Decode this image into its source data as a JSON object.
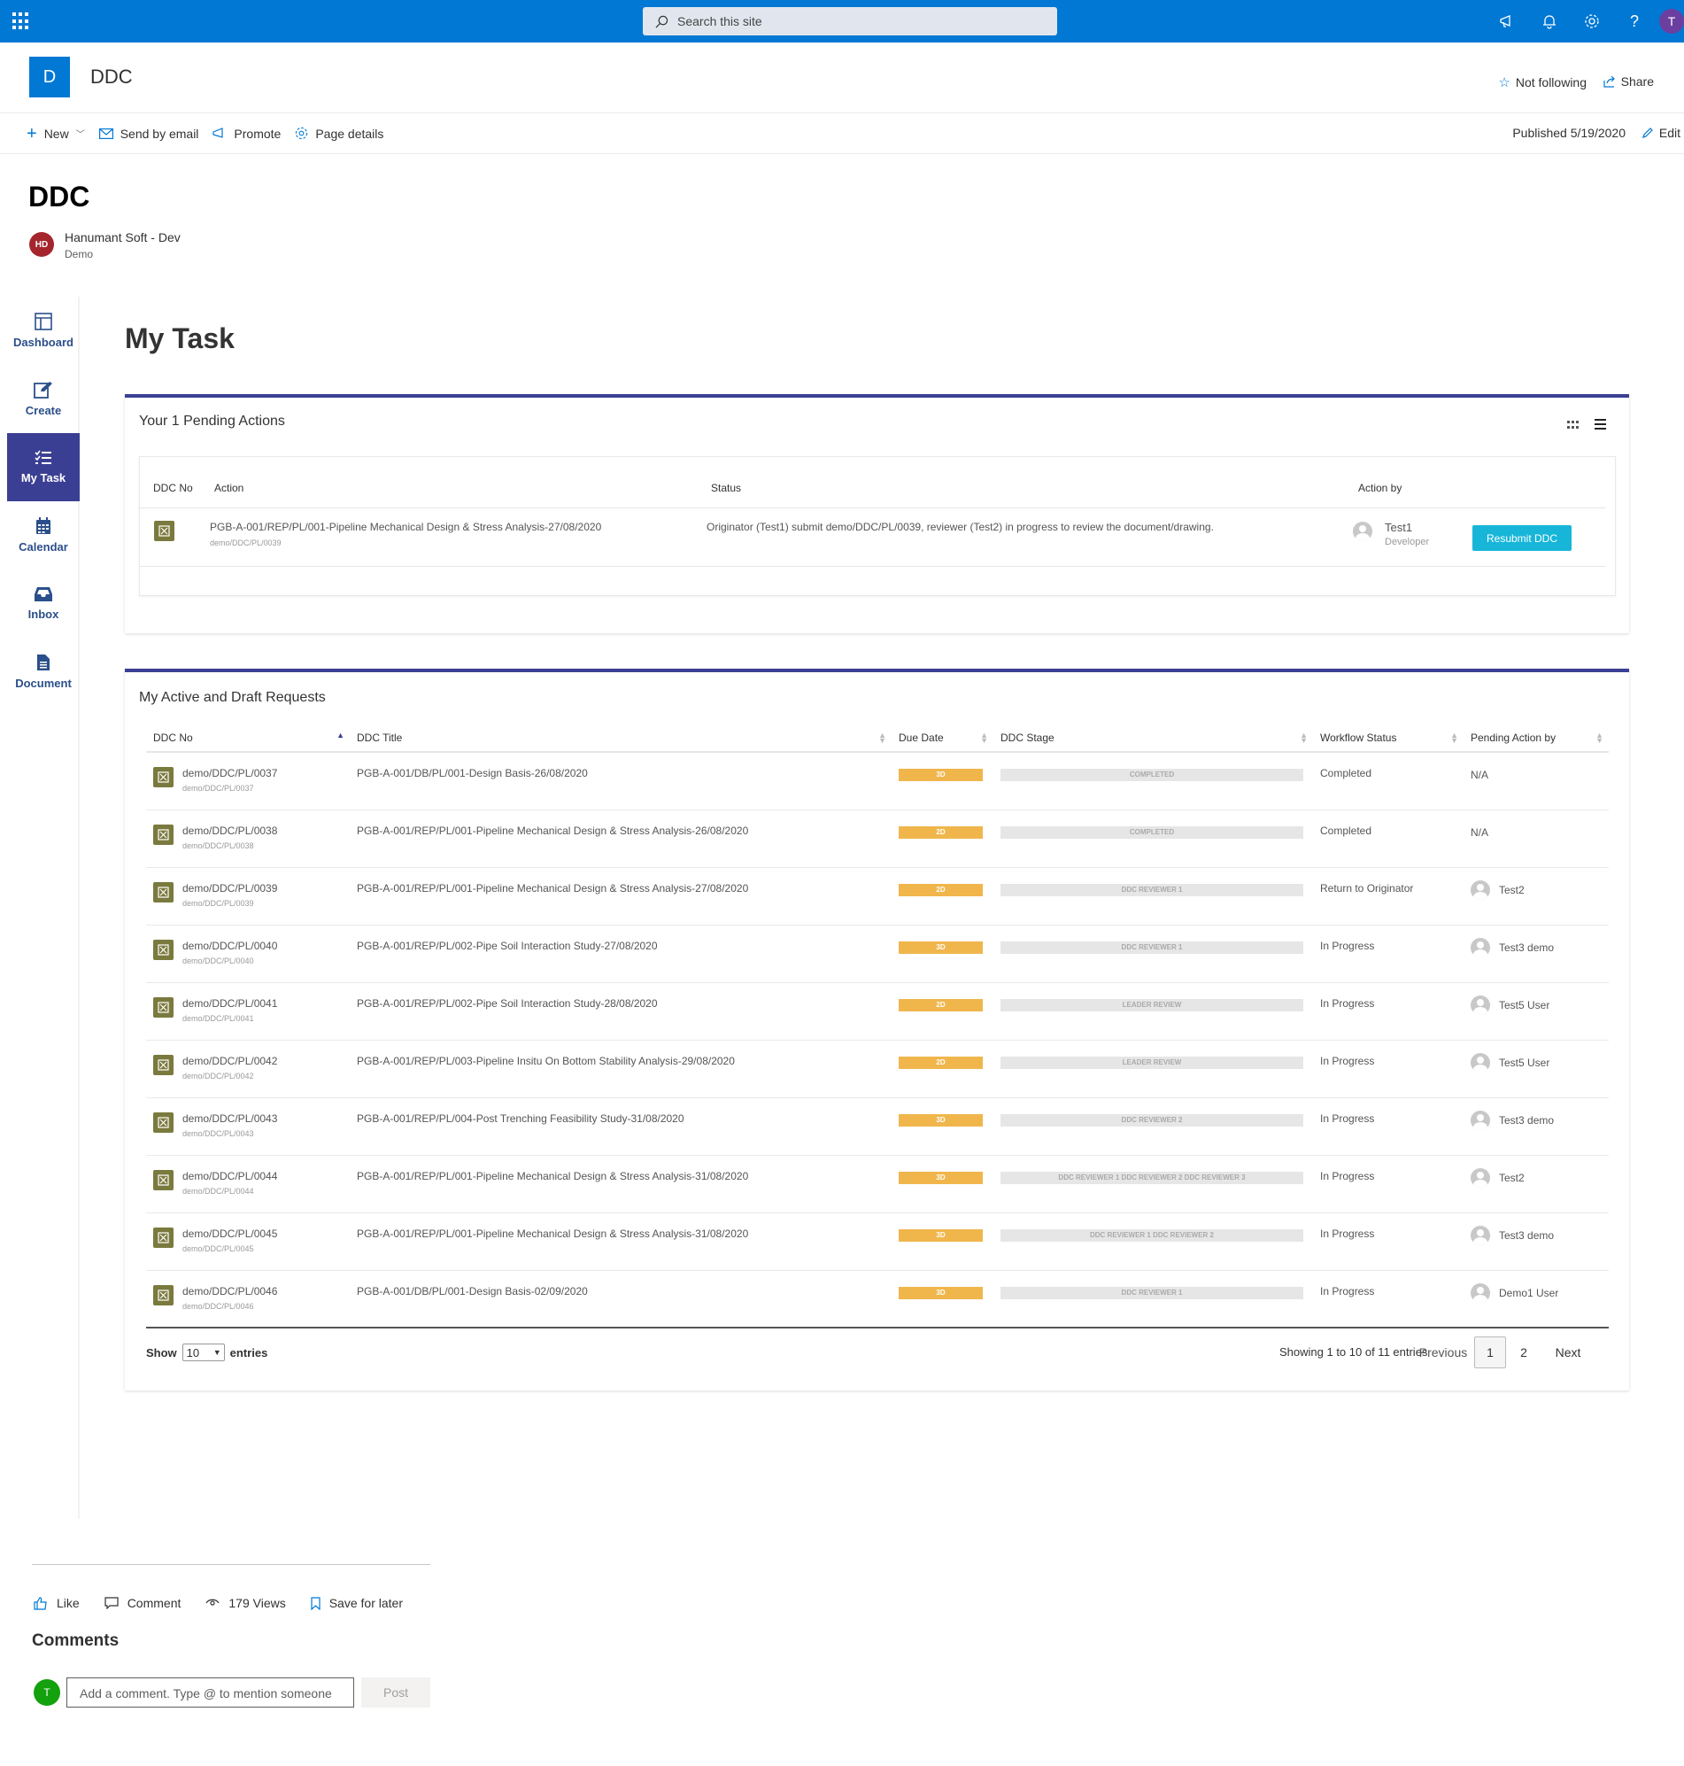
{
  "suite": {
    "search_placeholder": "Search this site",
    "user_initial": "T"
  },
  "site": {
    "logo_letter": "D",
    "title": "DDC",
    "follow_label": "Not following",
    "share_label": "Share"
  },
  "commandbar": {
    "new_label": "New",
    "email_label": "Send by email",
    "promote_label": "Promote",
    "details_label": "Page details",
    "published": "Published 5/19/2020",
    "edit_label": "Edit"
  },
  "page": {
    "title": "DDC",
    "author_initials": "HD",
    "author_name": "Hanumant Soft - Dev",
    "author_sub": "Demo"
  },
  "nav": {
    "items": [
      {
        "label": "Dashboard"
      },
      {
        "label": "Create"
      },
      {
        "label": "My Task"
      },
      {
        "label": "Calendar"
      },
      {
        "label": "Inbox"
      },
      {
        "label": "Document"
      }
    ]
  },
  "main": {
    "heading": "My Task"
  },
  "pending": {
    "title": "Your 1 Pending Actions",
    "headers": {
      "ddc_no": "DDC No",
      "action": "Action",
      "status": "Status",
      "action_by": "Action by"
    },
    "row": {
      "action": "PGB-A-001/REP/PL/001-Pipeline Mechanical Design & Stress Analysis-27/08/2020",
      "action_sub": "demo/DDC/PL/0039",
      "status": "Originator (Test1) submit demo/DDC/PL/0039, reviewer (Test2) in progress to review the document/drawing.",
      "person": "Test1",
      "role": "Developer",
      "button": "Resubmit DDC"
    }
  },
  "requests": {
    "title": "My Active and Draft Requests",
    "headers": {
      "ddc_no": "DDC No",
      "title": "DDC Title",
      "due": "Due Date",
      "stage": "DDC Stage",
      "workflow": "Workflow Status",
      "pending": "Pending Action by"
    },
    "rows": [
      {
        "no": "demo/DDC/PL/0037",
        "sub": "demo/DDC/PL/0037",
        "title": "PGB-A-001/DB/PL/001-Design Basis-26/08/2020",
        "due": "3D",
        "stage": "COMPLETED",
        "status": "Completed",
        "by": "N/A",
        "avatar": false
      },
      {
        "no": "demo/DDC/PL/0038",
        "sub": "demo/DDC/PL/0038",
        "title": "PGB-A-001/REP/PL/001-Pipeline Mechanical Design & Stress Analysis-26/08/2020",
        "due": "2D",
        "stage": "COMPLETED",
        "status": "Completed",
        "by": "N/A",
        "avatar": false
      },
      {
        "no": "demo/DDC/PL/0039",
        "sub": "demo/DDC/PL/0039",
        "title": "PGB-A-001/REP/PL/001-Pipeline Mechanical Design & Stress Analysis-27/08/2020",
        "due": "2D",
        "stage": "DDC REVIEWER 1",
        "status": "Return to Originator",
        "by": "Test2",
        "avatar": true
      },
      {
        "no": "demo/DDC/PL/0040",
        "sub": "demo/DDC/PL/0040",
        "title": "PGB-A-001/REP/PL/002-Pipe Soil Interaction Study-27/08/2020",
        "due": "3D",
        "stage": "DDC REVIEWER 1",
        "status": "In Progress",
        "by": "Test3 demo",
        "avatar": true
      },
      {
        "no": "demo/DDC/PL/0041",
        "sub": "demo/DDC/PL/0041",
        "title": "PGB-A-001/REP/PL/002-Pipe Soil Interaction Study-28/08/2020",
        "due": "2D",
        "stage": "LEADER REVIEW",
        "status": "In Progress",
        "by": "Test5 User",
        "avatar": true
      },
      {
        "no": "demo/DDC/PL/0042",
        "sub": "demo/DDC/PL/0042",
        "title": "PGB-A-001/REP/PL/003-Pipeline Insitu On Bottom Stability Analysis-29/08/2020",
        "due": "2D",
        "stage": "LEADER REVIEW",
        "status": "In Progress",
        "by": "Test5 User",
        "avatar": true
      },
      {
        "no": "demo/DDC/PL/0043",
        "sub": "demo/DDC/PL/0043",
        "title": "PGB-A-001/REP/PL/004-Post Trenching Feasibility Study-31/08/2020",
        "due": "3D",
        "stage": "DDC REVIEWER 2",
        "status": "In Progress",
        "by": "Test3 demo",
        "avatar": true
      },
      {
        "no": "demo/DDC/PL/0044",
        "sub": "demo/DDC/PL/0044",
        "title": "PGB-A-001/REP/PL/001-Pipeline Mechanical Design & Stress Analysis-31/08/2020",
        "due": "3D",
        "stage": "DDC REVIEWER 1 DDC REVIEWER 2 DDC REVIEWER 3",
        "status": "In Progress",
        "by": "Test2",
        "avatar": true
      },
      {
        "no": "demo/DDC/PL/0045",
        "sub": "demo/DDC/PL/0045",
        "title": "PGB-A-001/REP/PL/001-Pipeline Mechanical Design & Stress Analysis-31/08/2020",
        "due": "3D",
        "stage": "DDC REVIEWER 1 DDC REVIEWER 2",
        "status": "In Progress",
        "by": "Test3 demo",
        "avatar": true
      },
      {
        "no": "demo/DDC/PL/0046",
        "sub": "demo/DDC/PL/0046",
        "title": "PGB-A-001/DB/PL/001-Design Basis-02/09/2020",
        "due": "3D",
        "stage": "DDC REVIEWER 1",
        "status": "In Progress",
        "by": "Demo1 User",
        "avatar": true
      }
    ],
    "show_label": "Show",
    "entries_value": "10",
    "entries_label": "entries",
    "info": "Showing 1 to 10 of 11 entries",
    "prev": "Previous",
    "page1": "1",
    "page2": "2",
    "next": "Next"
  },
  "social": {
    "like": "Like",
    "comment": "Comment",
    "views": "179 Views",
    "save": "Save for later"
  },
  "comments": {
    "heading": "Comments",
    "avatar_initial": "T",
    "placeholder": "Add a comment. Type @ to mention someone",
    "post": "Post"
  },
  "colors": {
    "suite_bar": "#0078d4",
    "nav_active": "#3b3f94",
    "due_badge": "#f0b64c",
    "resubmit": "#17b6d9"
  }
}
